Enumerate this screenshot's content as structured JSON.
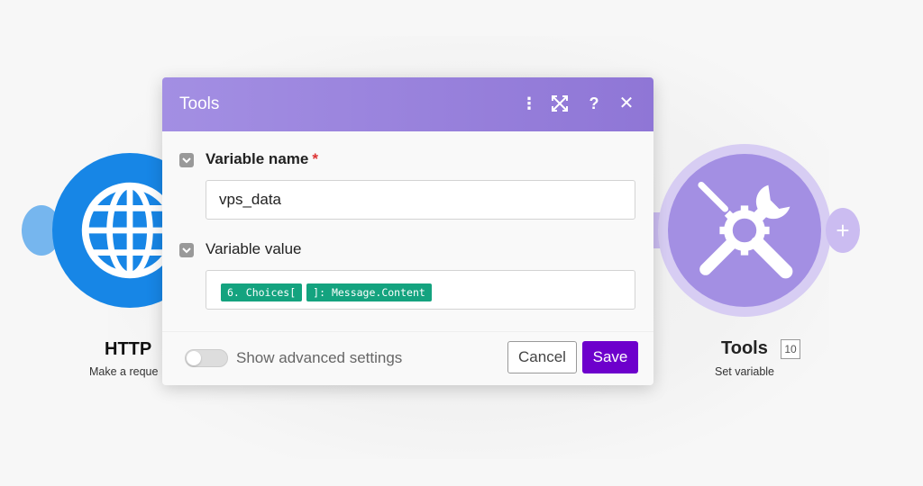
{
  "canvas": {
    "http_module": {
      "name": "HTTP",
      "subtitle": "Make a reque",
      "icon": "globe-icon",
      "color": "#1786e6"
    },
    "tools_module": {
      "name": "Tools",
      "badge": "10",
      "subtitle": "Set variable",
      "icon": "tools-icon",
      "color": "#a38fe3",
      "add_symbol": "+"
    }
  },
  "dialog": {
    "title": "Tools",
    "header_icons": [
      "more-vertical-icon",
      "expand-icon",
      "help-icon",
      "close-icon"
    ],
    "header_icon_glyphs": {
      "more": "⋮",
      "help": "?",
      "close": "✕"
    },
    "fields": {
      "variable_name": {
        "label": "Variable name",
        "required_mark": "*",
        "value": "vps_data"
      },
      "variable_value": {
        "label": "Variable value",
        "tokens": [
          "6. Choices[",
          "]: Message.Content"
        ]
      }
    },
    "footer": {
      "advanced_label": "Show advanced settings",
      "advanced_enabled": false,
      "cancel_label": "Cancel",
      "save_label": "Save"
    }
  },
  "colors": {
    "header_purple": "#9a84df",
    "save_button": "#6d00cc",
    "token_green": "#14a37f",
    "required_red": "#dd3333"
  }
}
